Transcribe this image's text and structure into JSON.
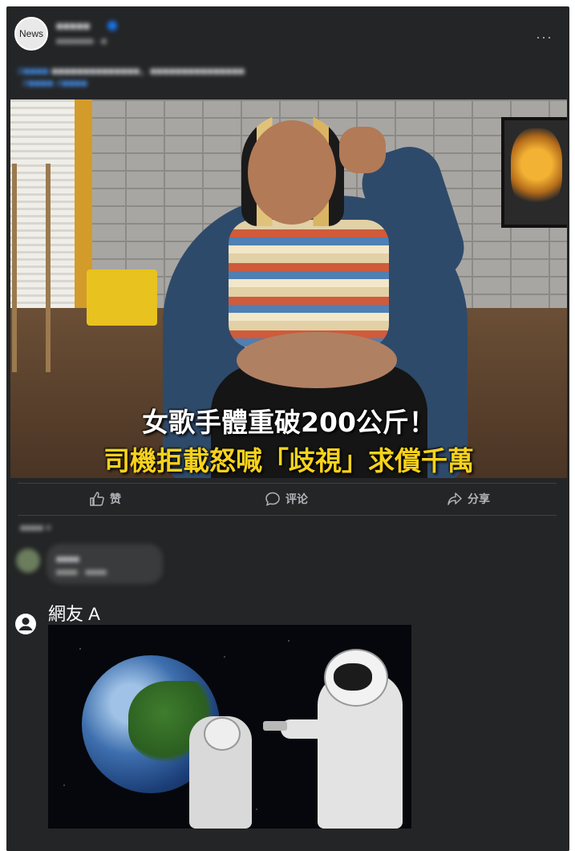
{
  "post": {
    "avatar_label": "News",
    "page_name": "■■■■■",
    "meta": "■■■■■■■ · ■",
    "caption_link": "#■■■■",
    "caption_text": " ■■■■■■■■■■■■■■，■■■■■■■■■■■■■■■",
    "caption_tags": "#■■■■ #■■■■",
    "image": {
      "headline_line1": "女歌手體重破200公斤！",
      "headline_line2": "司機拒載怒喊「歧視」求償千萬"
    }
  },
  "actions": {
    "like": "赞",
    "comment": "评论",
    "share": "分享"
  },
  "comments": {
    "sort_label": "■■■■ ▾",
    "first": {
      "name": "■■■■",
      "text": "■■■■ · ■■■■"
    },
    "overlay": {
      "user": "網友 A",
      "meme_desc": "astronauts meme"
    }
  },
  "colors": {
    "background": "#242526",
    "headline_yellow": "#f8d21c",
    "link_blue": "#4599ff"
  }
}
